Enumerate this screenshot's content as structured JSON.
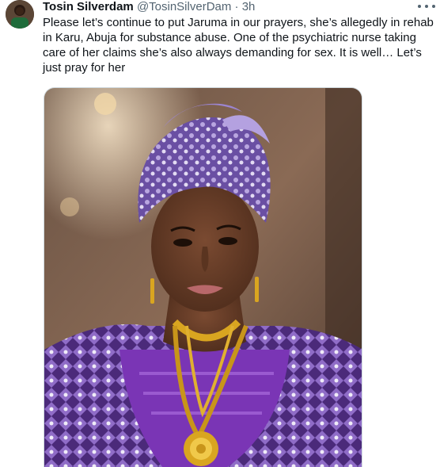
{
  "tweet": {
    "display_name": "Tosin Silverdam",
    "handle": "@TosinSilverDam",
    "separator": "·",
    "time": "3h",
    "text": "Please let’s continue to put Jaruma in our prayers, she’s allegedly in rehab in Karu, Abuja for substance abuse. One of the psychiatric nurse taking care of her claims she’s also always demanding for sex. It is well… Let’s just pray for her",
    "more_icon": "more-horizontal-icon"
  },
  "colors": {
    "text": "#0f1419",
    "secondary": "#536471",
    "border": "#cfd9de",
    "gele_purple": "#6a4fa3",
    "dress_purple": "#7a35b5",
    "gold": "#d9a520"
  }
}
